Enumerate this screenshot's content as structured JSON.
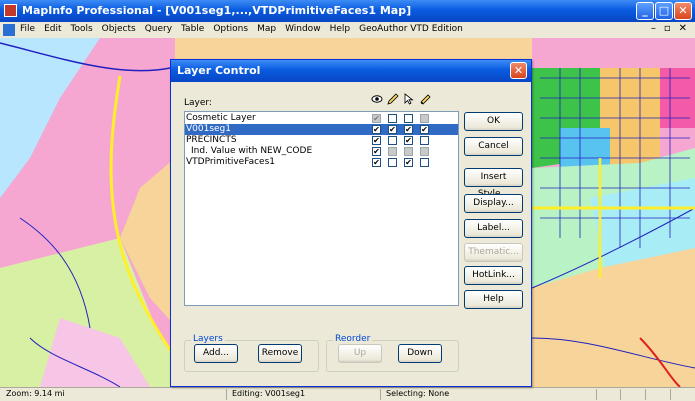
{
  "window": {
    "title": "MapInfo Professional - [V001seg1,...,VTDPrimitiveFaces1 Map]"
  },
  "menubar": {
    "items": [
      "File",
      "Edit",
      "Tools",
      "Objects",
      "Query",
      "Table",
      "Options",
      "Map",
      "Window",
      "Help",
      "GeoAuthor VTD Edition"
    ]
  },
  "dialog": {
    "title": "Layer Control",
    "layer_label": "Layer:",
    "column_icons": [
      "visible-icon",
      "editable-icon",
      "selectable-icon",
      "autolabel-icon"
    ],
    "layers": [
      {
        "name": "Cosmetic Layer",
        "checks": [
          true,
          false,
          false,
          false
        ],
        "disabled": [
          true,
          false,
          false,
          true
        ],
        "selected": false
      },
      {
        "name": "V001seg1",
        "checks": [
          true,
          true,
          true,
          true
        ],
        "disabled": [
          false,
          false,
          false,
          false
        ],
        "selected": true
      },
      {
        "name": "PRECINCTS",
        "checks": [
          true,
          false,
          true,
          false
        ],
        "disabled": [
          false,
          false,
          false,
          false
        ],
        "selected": false
      },
      {
        "name": "Ind. Value with NEW_CODE",
        "checks": [
          true,
          false,
          false,
          false
        ],
        "disabled": [
          false,
          true,
          true,
          true
        ],
        "selected": false
      },
      {
        "name": "VTDPrimitiveFaces1",
        "checks": [
          true,
          false,
          true,
          false
        ],
        "disabled": [
          false,
          false,
          false,
          false
        ],
        "selected": false
      }
    ],
    "buttons": {
      "ok": "OK",
      "cancel": "Cancel",
      "insert_style": "Insert Style...",
      "display": "Display...",
      "label": "Label...",
      "thematic": "Thematic...",
      "hotlink": "HotLink...",
      "help": "Help"
    },
    "layers_group": {
      "title": "Layers",
      "add": "Add...",
      "remove": "Remove"
    },
    "reorder_group": {
      "title": "Reorder",
      "up": "Up",
      "down": "Down"
    }
  },
  "statusbar": {
    "zoom": "Zoom: 9.14 mi",
    "editing": "Editing: V001seg1",
    "selecting": "Selecting: None"
  }
}
